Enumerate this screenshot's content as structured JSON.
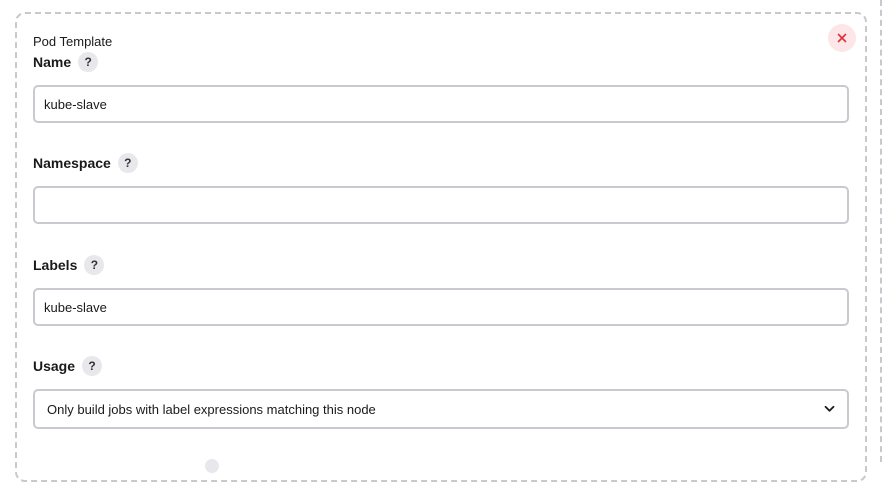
{
  "pod_template": {
    "title": "Pod Template",
    "close_icon": "close-icon",
    "close_color": "#e0303d",
    "fields": {
      "name": {
        "label": "Name",
        "value": "kube-slave",
        "help": "?"
      },
      "namespace": {
        "label": "Namespace",
        "value": "",
        "help": "?"
      },
      "labels": {
        "label": "Labels",
        "value": "kube-slave",
        "help": "?"
      },
      "usage": {
        "label": "Usage",
        "selected": "Only build jobs with label expressions matching this node",
        "help": "?"
      }
    }
  }
}
